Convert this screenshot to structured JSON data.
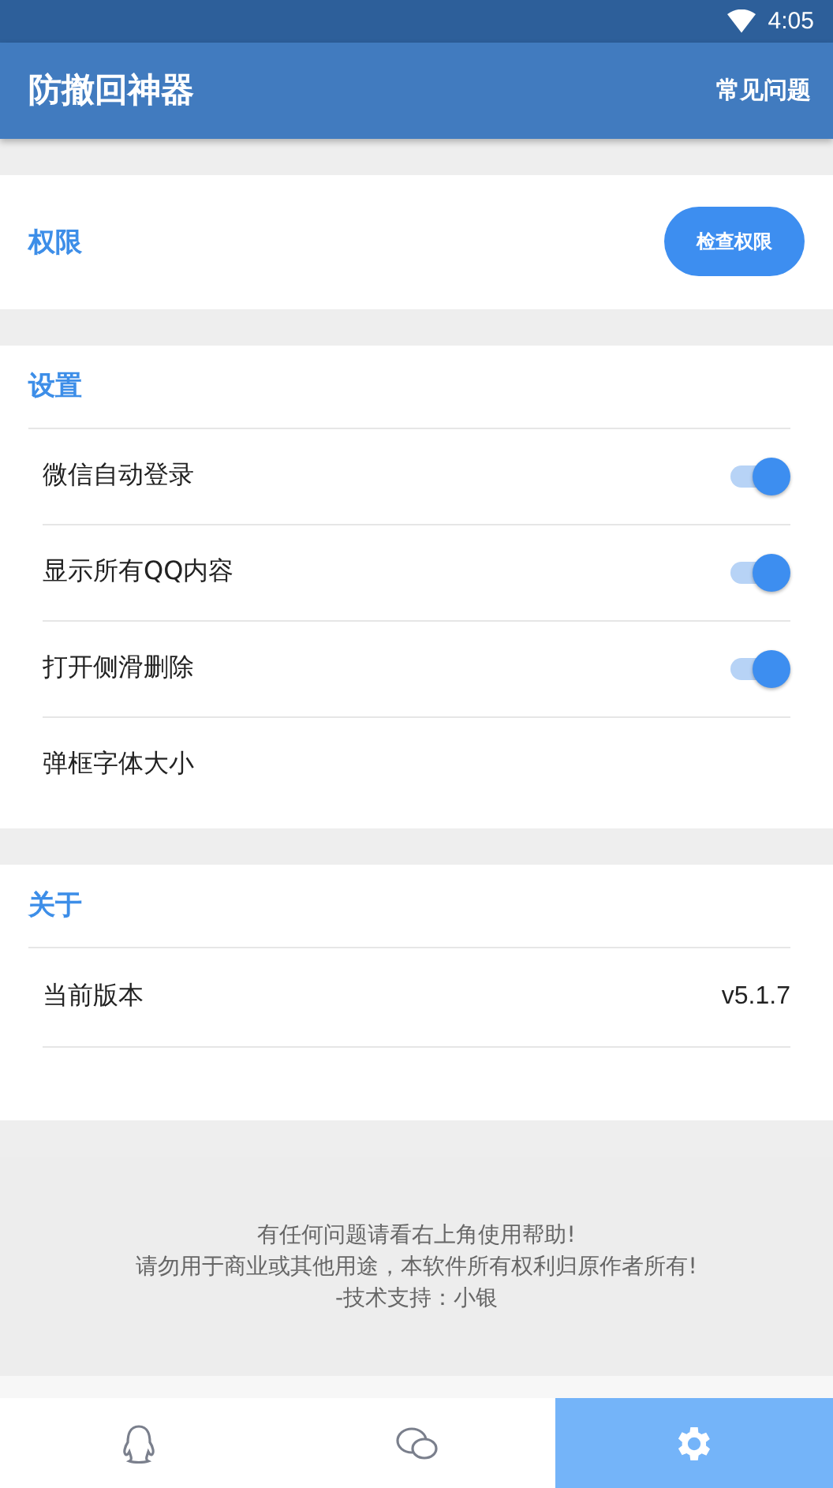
{
  "status_bar": {
    "time": "4:05"
  },
  "app_bar": {
    "title": "防撤回神器",
    "action": "常见问题"
  },
  "permissions": {
    "heading": "权限",
    "button": "检查权限"
  },
  "settings": {
    "heading": "设置",
    "items": [
      {
        "kind": "toggle",
        "label": "微信自动登录",
        "on": true
      },
      {
        "kind": "toggle",
        "label": "显示所有QQ内容",
        "on": true
      },
      {
        "kind": "toggle",
        "label": "打开侧滑删除",
        "on": true
      },
      {
        "kind": "plain",
        "label": "弹框字体大小"
      }
    ]
  },
  "about": {
    "heading": "关于",
    "items": [
      {
        "label": "当前版本",
        "value": "v5.1.7"
      }
    ]
  },
  "footer": {
    "lines": [
      "有任何问题请看右上角使用帮助!",
      "请勿用于商业或其他用途，本软件所有权利归原作者所有!",
      "-技术支持：小银"
    ]
  },
  "bottom_nav": [
    {
      "selected": false
    },
    {
      "selected": false
    },
    {
      "selected": true
    }
  ]
}
